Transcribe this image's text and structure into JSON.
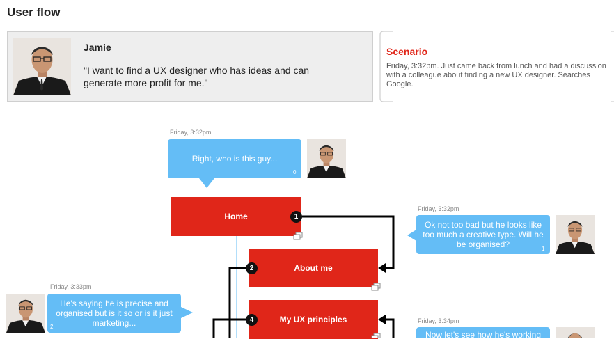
{
  "page": {
    "title": "User flow"
  },
  "persona": {
    "name": "Jamie",
    "quote": "\"I want to find a UX designer who has ideas and can generate more profit for me.\""
  },
  "scenario": {
    "title": "Scenario",
    "text": "Friday, 3:32pm. Just came back from lunch and had a discussion with a colleague about finding a new UX designer. Searches Google."
  },
  "flow": {
    "steps": [
      {
        "label": "Home",
        "badge": "1"
      },
      {
        "label": "About me",
        "badge": "2"
      },
      {
        "label": "My UX principles",
        "badge": "4"
      }
    ],
    "comments": [
      {
        "time": "Friday, 3:32pm",
        "text": "Right, who is this guy...",
        "count": "0"
      },
      {
        "time": "Friday, 3:32pm",
        "text": "Ok not too bad but he looks like too much a creative type. Will he be organised?",
        "count": "1"
      },
      {
        "time": "Friday, 3:33pm",
        "text": "He's saying he is precise and organised but is it so or is it just marketing...",
        "count": "2"
      },
      {
        "time": "Friday, 3:34pm",
        "text": "Now let's see how he's working",
        "count": ""
      }
    ]
  },
  "colors": {
    "accent": "#e02619",
    "bubble": "#64bdf6",
    "connector": "#000000"
  },
  "icons": {
    "copy": "copy-icon"
  }
}
